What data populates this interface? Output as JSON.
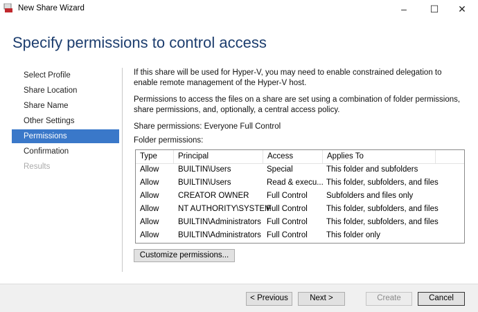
{
  "window": {
    "title": "New Share Wizard",
    "controls": {
      "minimize": "–",
      "maximize": "☐",
      "close": "✕"
    }
  },
  "heading": "Specify permissions to control access",
  "nav": [
    {
      "label": "Select Profile",
      "state": "normal"
    },
    {
      "label": "Share Location",
      "state": "normal"
    },
    {
      "label": "Share Name",
      "state": "normal"
    },
    {
      "label": "Other Settings",
      "state": "normal"
    },
    {
      "label": "Permissions",
      "state": "selected"
    },
    {
      "label": "Confirmation",
      "state": "normal"
    },
    {
      "label": "Results",
      "state": "disabled"
    }
  ],
  "content": {
    "hyperv_note": "If this share will be used for Hyper-V, you may need to enable constrained delegation to enable remote management of the Hyper-V host.",
    "permissions_note": "Permissions to access the files on a share are set using a combination of folder permissions, share permissions, and, optionally, a central access policy.",
    "share_permissions": "Share permissions:  Everyone Full Control",
    "folder_permissions_label": "Folder permissions:",
    "table": {
      "columns": [
        "Type",
        "Principal",
        "Access",
        "Applies To"
      ],
      "rows": [
        [
          "Allow",
          "BUILTIN\\Users",
          "Special",
          "This folder and subfolders"
        ],
        [
          "Allow",
          "BUILTIN\\Users",
          "Read & execu...",
          "This folder, subfolders, and files"
        ],
        [
          "Allow",
          "CREATOR OWNER",
          "Full Control",
          "Subfolders and files only"
        ],
        [
          "Allow",
          "NT AUTHORITY\\SYSTEM",
          "Full Control",
          "This folder, subfolders, and files"
        ],
        [
          "Allow",
          "BUILTIN\\Administrators",
          "Full Control",
          "This folder, subfolders, and files"
        ],
        [
          "Allow",
          "BUILTIN\\Administrators",
          "Full Control",
          "This folder only"
        ]
      ]
    },
    "customize_button": "Customize permissions..."
  },
  "footer": {
    "previous": "< Previous",
    "next": "Next >",
    "create": "Create",
    "cancel": "Cancel"
  }
}
